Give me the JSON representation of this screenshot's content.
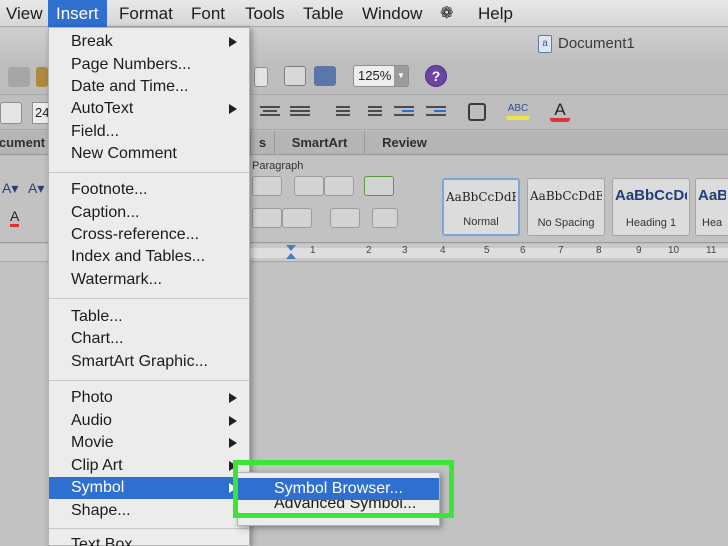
{
  "menubar": {
    "items": [
      {
        "label": "View"
      },
      {
        "label": "Insert"
      },
      {
        "label": "Format"
      },
      {
        "label": "Font"
      },
      {
        "label": "Tools"
      },
      {
        "label": "Table"
      },
      {
        "label": "Window"
      },
      {
        "label": "Help"
      }
    ],
    "script_icon": "script-menu-icon"
  },
  "window": {
    "doc_title": "Document1",
    "zoom": "125%",
    "font_size": "24",
    "ribbon_tabs": [
      "cument",
      "s",
      "SmartArt",
      "Review"
    ],
    "paragraph_group_label": "Paragraph",
    "styles": [
      {
        "sample": "AaBbCcDdEe",
        "name": "Normal"
      },
      {
        "sample": "AaBbCcDdEe",
        "name": "No Spacing"
      },
      {
        "sample": "AaBbCcDd",
        "name": "Heading 1"
      },
      {
        "sample": "AaBb",
        "name": "Hea"
      }
    ],
    "ruler_numbers": [
      "1",
      "2",
      "3",
      "4",
      "5",
      "6",
      "7",
      "8",
      "9",
      "10",
      "11"
    ]
  },
  "insert_menu": {
    "items": [
      {
        "label": "Break",
        "submenu": true
      },
      {
        "label": "Page Numbers..."
      },
      {
        "label": "Date and Time..."
      },
      {
        "label": "AutoText",
        "submenu": true
      },
      {
        "label": "Field..."
      },
      {
        "label": "New Comment"
      },
      {
        "label": "Footnote..."
      },
      {
        "label": "Caption..."
      },
      {
        "label": "Cross-reference..."
      },
      {
        "label": "Index and Tables..."
      },
      {
        "label": "Watermark..."
      },
      {
        "label": "Table..."
      },
      {
        "label": "Chart..."
      },
      {
        "label": "SmartArt Graphic..."
      },
      {
        "label": "Photo",
        "submenu": true
      },
      {
        "label": "Audio",
        "submenu": true
      },
      {
        "label": "Movie",
        "submenu": true
      },
      {
        "label": "Clip Art",
        "submenu": true
      },
      {
        "label": "Symbol",
        "submenu": true,
        "highlighted": true
      },
      {
        "label": "Shape..."
      },
      {
        "label": "Text Box"
      }
    ]
  },
  "symbol_submenu": {
    "items": [
      {
        "label": "Symbol Browser...",
        "highlighted": true
      },
      {
        "label": "Advanced Symbol..."
      }
    ]
  },
  "colors": {
    "highlight": "#2f6fd0",
    "callout_border": "#39e636"
  }
}
